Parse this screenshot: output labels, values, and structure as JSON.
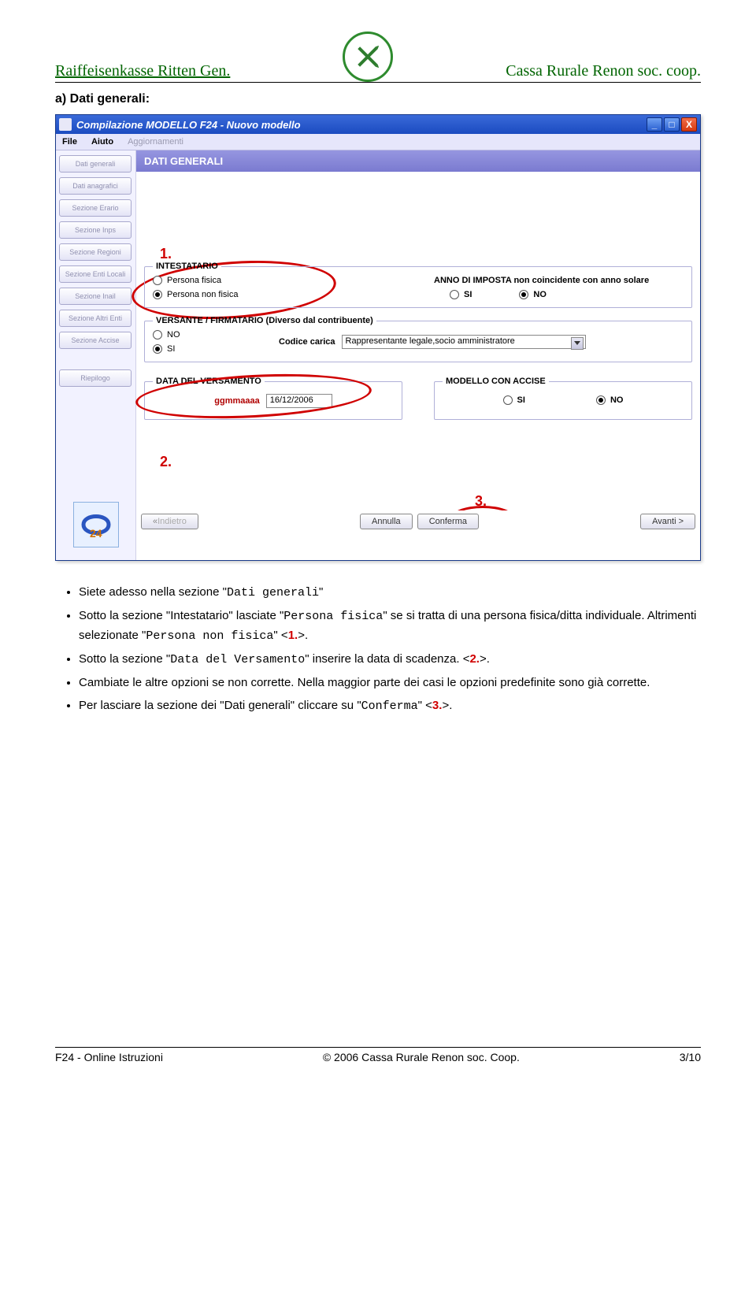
{
  "header": {
    "left": "Raiffeisenkasse Ritten Gen.",
    "right": "Cassa Rurale Renon soc. coop."
  },
  "section_title": "a) Dati generali:",
  "window": {
    "title": "Compilazione MODELLO F24 - Nuovo modello",
    "min_tip": "_",
    "max_tip": "□",
    "close_tip": "X",
    "menu": {
      "file": "File",
      "aiuto": "Aiuto",
      "aggiornamenti": "Aggiornamenti"
    },
    "sidebar_items": [
      "Dati generali",
      "Dati anagrafici",
      "Sezione Erario",
      "Sezione Inps",
      "Sezione Regioni",
      "Sezione Enti Locali",
      "Sezione Inail",
      "Sezione Altri Enti",
      "Sezione Accise",
      "Riepilogo"
    ],
    "banner": "DATI GENERALI",
    "annotations": {
      "a1": "1.",
      "a2": "2.",
      "a3": "3."
    },
    "intestatario": {
      "legend": "INTESTATARIO",
      "persona_fisica": "Persona fisica",
      "persona_non_fisica": "Persona  non fisica",
      "persona_fisica_selected": false,
      "persona_non_fisica_selected": true,
      "anno_label": "ANNO DI IMPOSTA non coincidente con anno solare",
      "si": "SI",
      "no": "NO",
      "anno_selected": "NO"
    },
    "versante": {
      "legend": "VERSANTE / FIRMATARIO (Diverso dal contribuente)",
      "no": "NO",
      "si": "SI",
      "selected": "SI",
      "codice_carica_label": "Codice carica",
      "codice_carica_value": "Rappresentante legale,socio amministratore"
    },
    "data_versamento": {
      "legend": "DATA DEL VERSAMENTO",
      "format_hint": "ggmmaaaa",
      "value": "16/12/2006"
    },
    "accise": {
      "legend": "MODELLO CON ACCISE",
      "si": "SI",
      "no": "NO",
      "selected": "NO"
    },
    "footer_buttons": {
      "indietro": "Indietro",
      "annulla": "Annulla",
      "conferma": "Conferma",
      "avanti": "Avanti >"
    }
  },
  "bullets": {
    "b1_a": "Siete adesso nella sezione \"",
    "b1_b_mono": "Dati generali",
    "b1_c": "\"",
    "b2_a": "Sotto la sezione \"Intestatario\" lasciate \"",
    "b2_b_mono": "Persona fisica",
    "b2_c": "\" se si tratta di una persona fisica/ditta individuale. Altrimenti selezionate \"",
    "b2_d_mono": "Persona non fisica",
    "b2_e": "\" <",
    "b2_f_red": "1.",
    "b2_g": ">.",
    "b3_a": "Sotto la sezione \"",
    "b3_b_mono": "Data del Versamento",
    "b3_c": "\" inserire la data di scadenza. <",
    "b3_d_red": "2.",
    "b3_e": ">.",
    "b4": "Cambiate le altre opzioni se non corrette. Nella maggior parte dei casi le opzioni predefinite sono già corrette.",
    "b5_a": "Per lasciare la sezione dei \"Dati generali\" cliccare su \"",
    "b5_b_mono": "Conferma",
    "b5_c": "\" <",
    "b5_d_red": "3.",
    "b5_e": ">."
  },
  "footer": {
    "left": "F24 - Online Istruzioni",
    "center": "© 2006 Cassa Rurale Renon soc. Coop.",
    "right": "3/10"
  }
}
